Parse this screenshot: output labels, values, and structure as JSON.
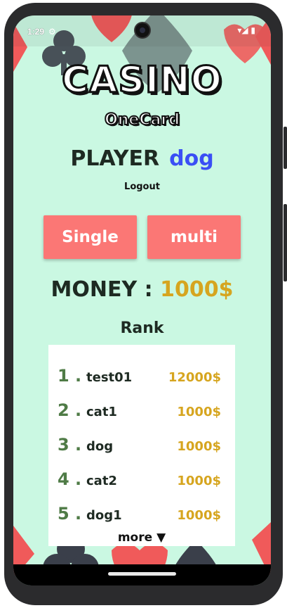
{
  "status_bar": {
    "time": "1:29"
  },
  "logo": {
    "main": "CASINO",
    "sub": "OneCard"
  },
  "player": {
    "label": "PLAYER",
    "name": "dog"
  },
  "logout_label": "Logout",
  "modes": {
    "single": "Single",
    "multi": "multi"
  },
  "money": {
    "label": "MONEY :",
    "value": "1000$"
  },
  "rank": {
    "title": "Rank",
    "rows": [
      {
        "num": "1 .",
        "name": "test01",
        "money": "12000$"
      },
      {
        "num": "2 .",
        "name": "cat1",
        "money": "1000$"
      },
      {
        "num": "3 .",
        "name": "dog",
        "money": "1000$"
      },
      {
        "num": "4 .",
        "name": "cat2",
        "money": "1000$"
      },
      {
        "num": "5 .",
        "name": "dog1",
        "money": "1000$"
      }
    ],
    "more_label": "more ▼"
  },
  "colors": {
    "background": "#caf8e2",
    "button": "#fb7775",
    "player_name": "#3a4ff5",
    "money": "#d6a51f",
    "rank_number": "#4f7b46"
  }
}
